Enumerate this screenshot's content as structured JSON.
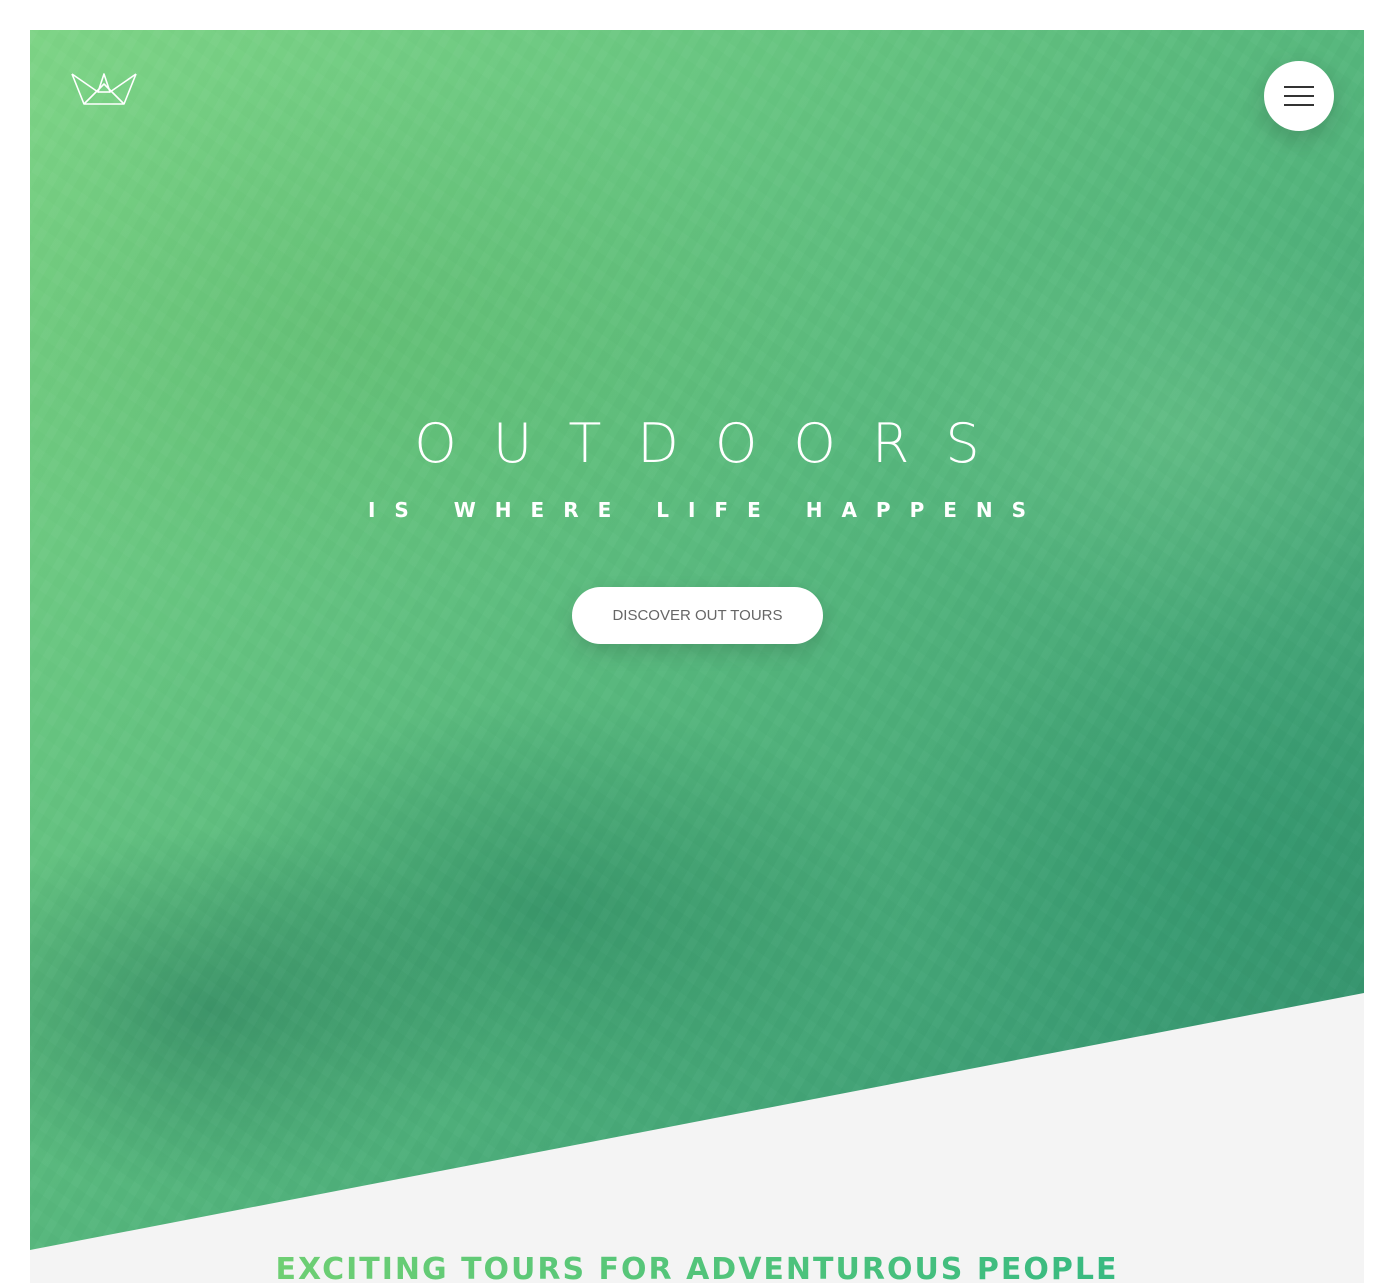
{
  "header": {
    "logo_icon": "crown-logo-icon",
    "menu_icon": "hamburger-menu-icon"
  },
  "hero": {
    "title": "OUTDOORS",
    "subtitle": "IS WHERE LIFE HAPPENS",
    "cta_label": "DISCOVER OUT TOURS"
  },
  "section": {
    "heading": "EXCITING TOURS FOR ADVENTUROUS PEOPLE"
  },
  "colors": {
    "primary_light": "#7ed56f",
    "primary_dark": "#28b485",
    "section_bg": "#f4f4f4",
    "button_bg": "#ffffff",
    "button_text": "#666666"
  }
}
